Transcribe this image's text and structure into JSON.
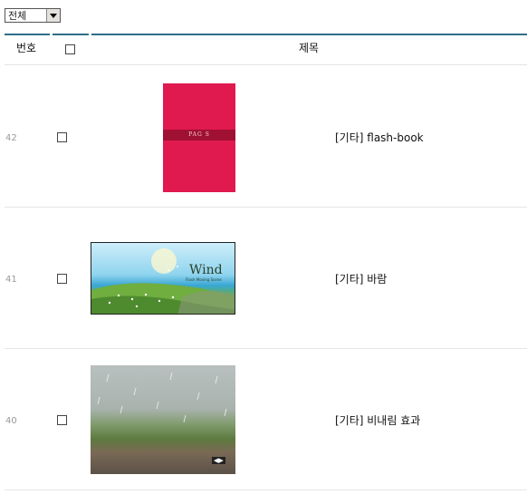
{
  "filter": {
    "selected": "전체"
  },
  "table": {
    "col_number": "번호",
    "col_title": "제목"
  },
  "rows": [
    {
      "number": "42",
      "category": "[기타]",
      "name": "flash-book",
      "title": "[기타] flash-book",
      "thumb_text": "PAG S"
    },
    {
      "number": "41",
      "category": "[기타]",
      "name": "바람",
      "title": "[기타] 바람",
      "thumb_text": "Wind",
      "thumb_subtext": "Flash Moving Scene"
    },
    {
      "number": "40",
      "category": "[기타]",
      "name": "비내림 효과",
      "title": "[기타] 비내림 효과",
      "thumb_text": "◀▶"
    }
  ],
  "colors": {
    "accent": "#2e6e87",
    "book": "#e01a4f"
  }
}
